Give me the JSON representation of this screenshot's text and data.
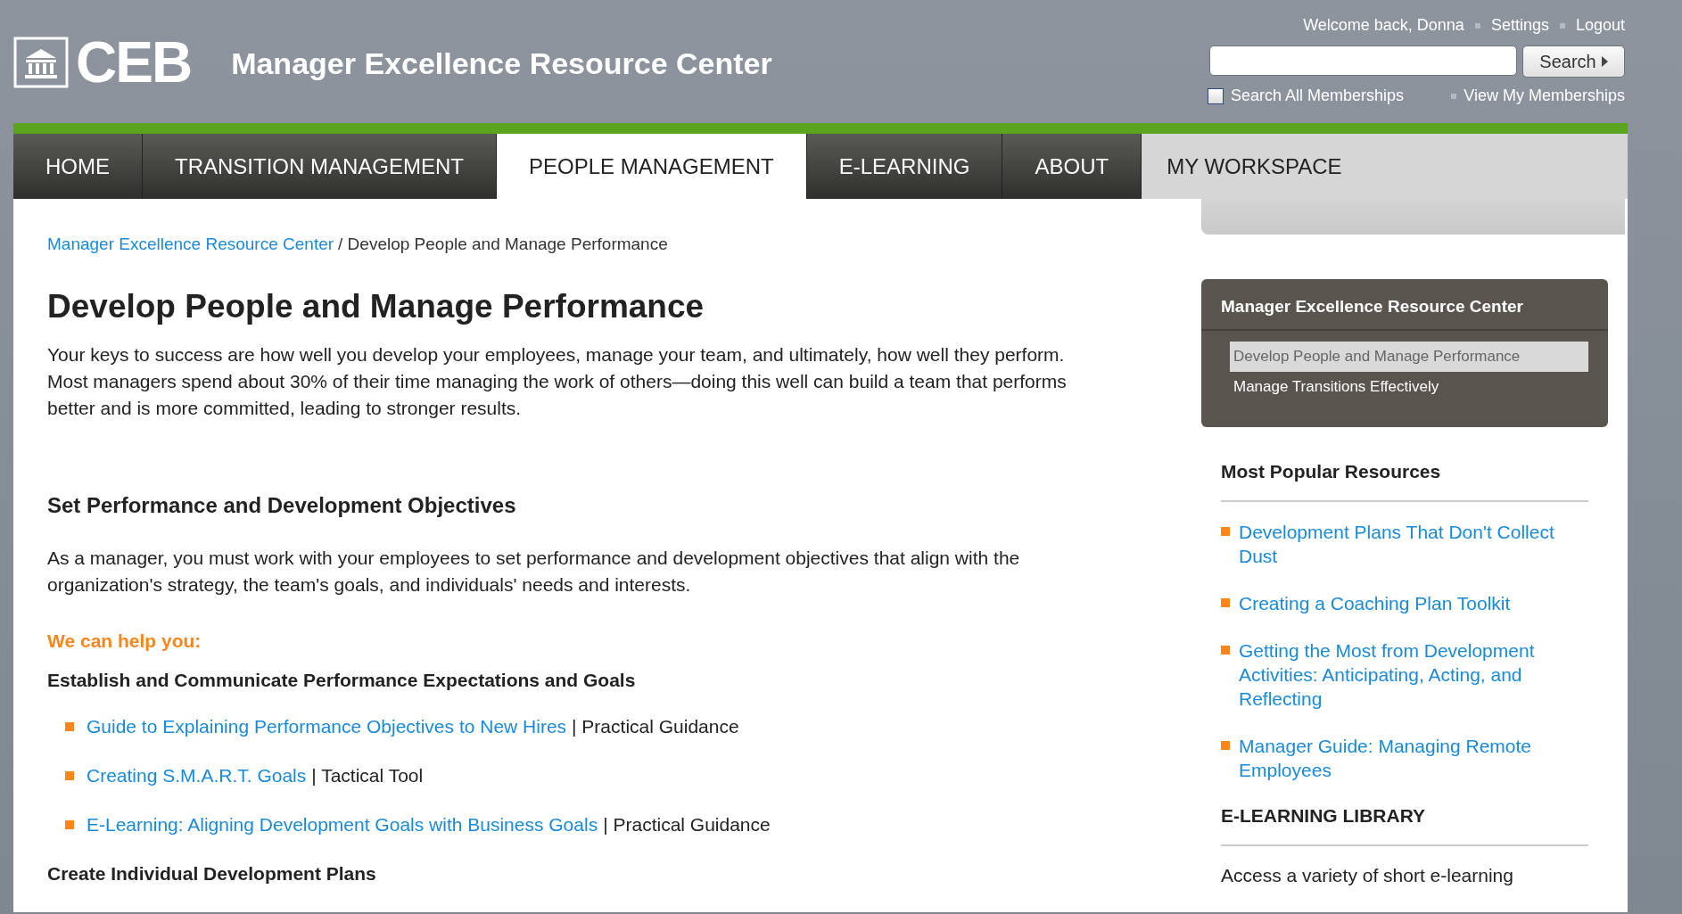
{
  "header": {
    "logo": "CEB",
    "title": "Manager Excellence Resource Center",
    "welcome": "Welcome back, Donna",
    "user_links": [
      "Settings",
      "Logout"
    ],
    "search": {
      "button": "Search",
      "scope": {
        "label": "Search All Memberships",
        "checked": false
      },
      "memberships_link": "View My Memberships"
    }
  },
  "nav": [
    {
      "label": "HOME",
      "selected": false
    },
    {
      "label": "TRANSITION MANAGEMENT",
      "selected": false
    },
    {
      "label": "PEOPLE MANAGEMENT",
      "selected": true
    },
    {
      "label": "E-LEARNING",
      "selected": false
    },
    {
      "label": "ABOUT",
      "selected": false
    }
  ],
  "workspace": {
    "label": "MY WORKSPACE"
  },
  "breadcrumb": {
    "link": "Manager Excellence Resource Center",
    "current": "/ Develop People and Manage Performance"
  },
  "main": {
    "title": "Develop People and Manage Performance",
    "intro": "Your keys to success are how well you develop your employees, manage your team, and ultimately, how well they perform. Most managers spend about 30% of their time managing the work of others—doing this well can build a team that performs better and is more committed, leading to stronger results.",
    "section": {
      "title": "Set Performance and Development Objectives",
      "text": "As a manager, you must work with your employees to set performance and development objectives that align with the organization's strategy, the team's goals, and individuals' needs and interests.",
      "help_label": "We can help you:",
      "groups": [
        {
          "title": "Establish and Communicate Performance Expectations and Goals",
          "items": [
            {
              "link": "Guide to Explaining Performance Objectives to New Hires",
              "type": "| Practical Guidance"
            },
            {
              "link": "Creating S.M.A.R.T. Goals",
              "type": "| Tactical Tool"
            },
            {
              "link": "E-Learning: Aligning Development Goals with Business Goals",
              "type": "| Practical Guidance"
            }
          ]
        },
        {
          "title": "Create Individual Development Plans"
        }
      ]
    }
  },
  "sidebar": {
    "nav_box": {
      "title": "Manager Excellence Resource Center",
      "items": [
        {
          "label": "Develop People and Manage Performance",
          "selected": true
        },
        {
          "label": "Manage Transitions Effectively",
          "selected": false
        }
      ]
    },
    "popular": {
      "title": "Most Popular Resources",
      "items": [
        "Development Plans That Don't Collect Dust",
        "Creating a Coaching Plan Toolkit",
        "Getting the Most from Development Activities: Anticipating, Acting, and Reflecting",
        "Manager Guide: Managing Remote Employees"
      ]
    },
    "library": {
      "title": "E-LEARNING LIBRARY",
      "text": "Access a variety of short e-learning"
    }
  }
}
